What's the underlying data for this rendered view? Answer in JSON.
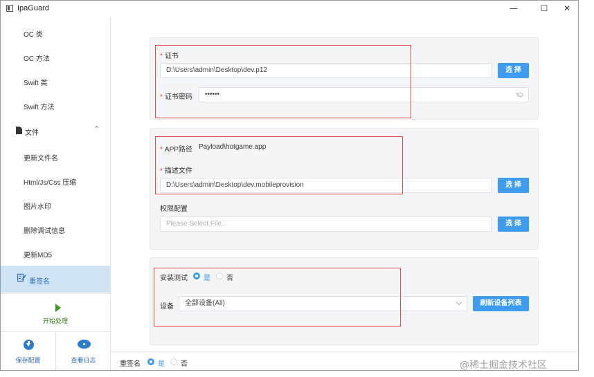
{
  "window": {
    "title": "IpaGuard",
    "minimize": "—",
    "maximize": "☐",
    "close": "✕"
  },
  "sidebar": {
    "items": [
      {
        "label": "OC 类"
      },
      {
        "label": "OC 方法"
      },
      {
        "label": "Swift 类"
      },
      {
        "label": "Swift 方法"
      }
    ],
    "group": {
      "label": "文件",
      "chevron": "⌃"
    },
    "file_items": [
      {
        "label": "更新文件名"
      },
      {
        "label": "Html/Js/Css 压缩"
      },
      {
        "label": "图片水印"
      },
      {
        "label": "删除调试信息"
      },
      {
        "label": "更新MD5"
      }
    ],
    "active_item": {
      "label": "重签名"
    },
    "start": {
      "label": "开始处理"
    },
    "save_config": {
      "label": "保存配置"
    },
    "view_log": {
      "label": "查看日志"
    }
  },
  "certificate": {
    "cert_label": "证书",
    "cert_value": "D:\\Users\\admin\\Desktop\\dev.p12",
    "cert_button": "选 择",
    "password_label": "证书密码",
    "password_value": "••••••"
  },
  "app": {
    "path_label": "APP路径",
    "path_value": "Payload\\hotgame.app",
    "profile_label": "描述文件",
    "profile_value": "D:\\Users\\admin\\Desktop\\dev.mobileprovision",
    "profile_button": "选 择",
    "entitlements_label": "权限配置",
    "entitlements_placeholder": "Please Select File...",
    "entitlements_button": "选 择"
  },
  "install": {
    "test_label": "安装测试",
    "yes": "是",
    "no": "否",
    "yes_selected": true,
    "device_label": "设备",
    "device_value": "全部设备(All)",
    "refresh_button": "刷新设备列表"
  },
  "footer": {
    "label": "重签名",
    "yes": "是",
    "no": "否",
    "yes_selected": true
  },
  "watermark": "@稀土掘金技术社区",
  "colors": {
    "accent": "#3d9bf0",
    "highlight": "#e8474b",
    "active_bg": "#cfe3f5",
    "start_green": "#3a9a1a"
  }
}
